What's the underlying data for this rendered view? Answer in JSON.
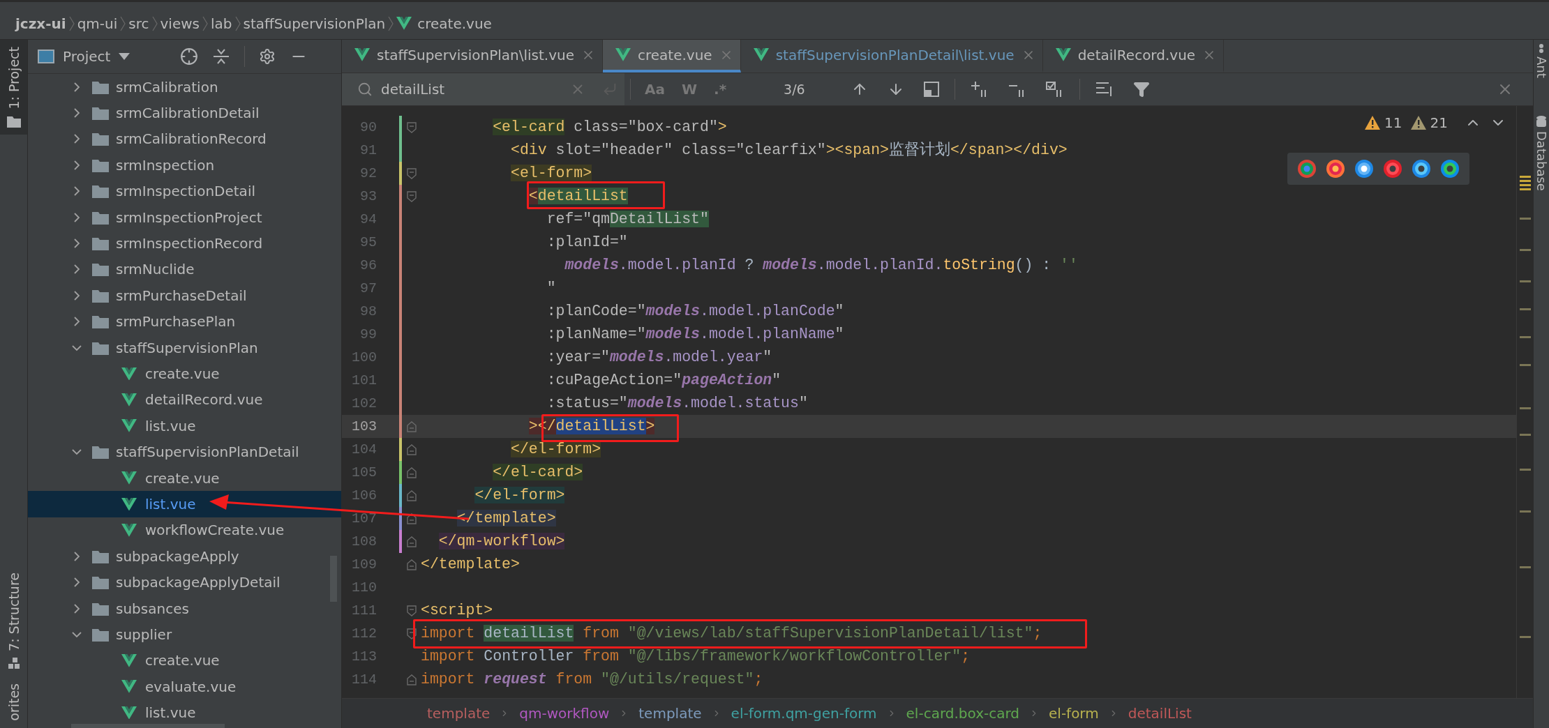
{
  "breadcrumb": [
    {
      "label": "jczx-ui",
      "kind": "project"
    },
    {
      "label": "qm-ui",
      "kind": "folder"
    },
    {
      "label": "src",
      "kind": "folder"
    },
    {
      "label": "views",
      "kind": "folder"
    },
    {
      "label": "lab",
      "kind": "folder"
    },
    {
      "label": "staffSupervisionPlan",
      "kind": "folder"
    },
    {
      "label": "create.vue",
      "kind": "file"
    }
  ],
  "left_tool_windows": [
    {
      "label": "1: Project",
      "selected": true
    },
    {
      "label": "7: Structure",
      "selected": false
    },
    {
      "label": "orites",
      "selected": false
    }
  ],
  "right_tool_windows": [
    {
      "label": "Ant"
    },
    {
      "label": "Database"
    }
  ],
  "project_panel": {
    "title": "Project",
    "tree": [
      {
        "name": "srmCalibration",
        "kind": "folder",
        "expanded": false,
        "selected": false
      },
      {
        "name": "srmCalibrationDetail",
        "kind": "folder",
        "expanded": false,
        "selected": false
      },
      {
        "name": "srmCalibrationRecord",
        "kind": "folder",
        "expanded": false,
        "selected": false
      },
      {
        "name": "srmInspection",
        "kind": "folder",
        "expanded": false,
        "selected": false
      },
      {
        "name": "srmInspectionDetail",
        "kind": "folder",
        "expanded": false,
        "selected": false
      },
      {
        "name": "srmInspectionProject",
        "kind": "folder",
        "expanded": false,
        "selected": false
      },
      {
        "name": "srmInspectionRecord",
        "kind": "folder",
        "expanded": false,
        "selected": false
      },
      {
        "name": "srmNuclide",
        "kind": "folder",
        "expanded": false,
        "selected": false
      },
      {
        "name": "srmPurchaseDetail",
        "kind": "folder",
        "expanded": false,
        "selected": false
      },
      {
        "name": "srmPurchasePlan",
        "kind": "folder",
        "expanded": false,
        "selected": false
      },
      {
        "name": "staffSupervisionPlan",
        "kind": "folder",
        "expanded": true,
        "selected": false,
        "children": [
          {
            "name": "create.vue",
            "kind": "file",
            "selected": false
          },
          {
            "name": "detailRecord.vue",
            "kind": "file",
            "selected": false
          },
          {
            "name": "list.vue",
            "kind": "file",
            "selected": false
          }
        ]
      },
      {
        "name": "staffSupervisionPlanDetail",
        "kind": "folder",
        "expanded": true,
        "selected": false,
        "children": [
          {
            "name": "create.vue",
            "kind": "file",
            "selected": false
          },
          {
            "name": "list.vue",
            "kind": "file",
            "selected": true
          },
          {
            "name": "workflowCreate.vue",
            "kind": "file",
            "selected": false
          }
        ]
      },
      {
        "name": "subpackageApply",
        "kind": "folder",
        "expanded": false,
        "selected": false
      },
      {
        "name": "subpackageApplyDetail",
        "kind": "folder",
        "expanded": false,
        "selected": false
      },
      {
        "name": "subsances",
        "kind": "folder",
        "expanded": false,
        "selected": false
      },
      {
        "name": "supplier",
        "kind": "folder",
        "expanded": true,
        "selected": false,
        "children": [
          {
            "name": "create.vue",
            "kind": "file",
            "selected": false
          },
          {
            "name": "evaluate.vue",
            "kind": "file",
            "selected": false
          },
          {
            "name": "list.vue",
            "kind": "file",
            "selected": false
          }
        ]
      }
    ]
  },
  "tabs": [
    {
      "label": "staffSupervisionPlan\\list.vue",
      "selected": false,
      "modified": false
    },
    {
      "label": "create.vue",
      "selected": true,
      "modified": false
    },
    {
      "label": "staffSupervisionPlanDetail\\list.vue",
      "selected": false,
      "modified": true
    },
    {
      "label": "detailRecord.vue",
      "selected": false,
      "modified": false
    }
  ],
  "search": {
    "value": "detailList",
    "options": [
      "Aa",
      "W",
      ".*"
    ],
    "count": "3/6"
  },
  "editor": {
    "inspections": [
      {
        "kind": "warning",
        "count": "11"
      },
      {
        "kind": "weak-warning",
        "count": "21"
      }
    ],
    "lines": [
      {
        "number": "90",
        "current": false,
        "color": "#6fbf8e",
        "fold_start": true,
        "fold_end": false,
        "tokens": [
          {
            "kind": "tag",
            "text": "        <el-card",
            "color": "#2f3e25"
          },
          {
            "kind": "attr",
            "text": " class=\"box-card\""
          },
          {
            "kind": "tag",
            "text": ">"
          }
        ]
      },
      {
        "number": "91",
        "current": false,
        "color": "#6fbf8e",
        "fold_start": false,
        "fold_end": false,
        "tokens": [
          {
            "kind": "tag",
            "text": "          <div"
          },
          {
            "kind": "attr",
            "text": " slot=\"header\" class=\"clearfix\""
          },
          {
            "kind": "tag",
            "text": "><span>"
          },
          {
            "kind": "text",
            "text": "监督计划"
          },
          {
            "kind": "tag",
            "text": "</span></div>"
          }
        ]
      },
      {
        "number": "92",
        "current": false,
        "color": "#c9c46a",
        "fold_start": true,
        "fold_end": false,
        "tokens": [
          {
            "kind": "tag",
            "text": "          <el-form>",
            "color": "#3d3b22"
          }
        ]
      },
      {
        "number": "93",
        "current": false,
        "color": "#c98376",
        "fold_start": true,
        "fold_end": false,
        "tokens": [
          {
            "kind": "tag",
            "text": "            <",
            "color": "#4d2a2a"
          },
          {
            "kind": "tag",
            "text": "detailList",
            "color": "#32593d"
          }
        ]
      },
      {
        "number": "94",
        "current": false,
        "color": "#c98376",
        "fold_start": false,
        "fold_end": false,
        "tokens": [
          {
            "kind": "attr",
            "text": "              ref=\"qm"
          },
          {
            "kind": "attr",
            "text": "DetailList\"",
            "color": "#32593d"
          }
        ]
      },
      {
        "number": "95",
        "current": false,
        "color": "#c98376",
        "fold_start": false,
        "fold_end": false,
        "tokens": [
          {
            "kind": "attr",
            "text": "              :planId=\""
          }
        ]
      },
      {
        "number": "96",
        "current": false,
        "color": "#c98376",
        "fold_start": false,
        "fold_end": false,
        "tokens": [
          {
            "kind": "var",
            "text": "                models"
          },
          {
            "kind": "prop",
            "text": ".model.planId "
          },
          {
            "kind": "text",
            "text": "? "
          },
          {
            "kind": "var",
            "text": "models"
          },
          {
            "kind": "prop",
            "text": ".model.planId."
          },
          {
            "kind": "func",
            "text": "toString"
          },
          {
            "kind": "text",
            "text": "() : "
          },
          {
            "kind": "jsstr",
            "text": "''"
          }
        ]
      },
      {
        "number": "97",
        "current": false,
        "color": "#c98376",
        "fold_start": false,
        "fold_end": false,
        "tokens": [
          {
            "kind": "attr",
            "text": "              \""
          }
        ]
      },
      {
        "number": "98",
        "current": false,
        "color": "#c98376",
        "fold_start": false,
        "fold_end": false,
        "tokens": [
          {
            "kind": "attr",
            "text": "              :planCode=\""
          },
          {
            "kind": "var",
            "text": "models"
          },
          {
            "kind": "prop",
            "text": ".model.planCode"
          },
          {
            "kind": "attr",
            "text": "\""
          }
        ]
      },
      {
        "number": "99",
        "current": false,
        "color": "#c98376",
        "fold_start": false,
        "fold_end": false,
        "tokens": [
          {
            "kind": "attr",
            "text": "              :planName=\""
          },
          {
            "kind": "var",
            "text": "models"
          },
          {
            "kind": "prop",
            "text": ".model.planName"
          },
          {
            "kind": "attr",
            "text": "\""
          }
        ]
      },
      {
        "number": "100",
        "current": false,
        "color": "#c98376",
        "fold_start": false,
        "fold_end": false,
        "tokens": [
          {
            "kind": "attr",
            "text": "              :year=\""
          },
          {
            "kind": "var",
            "text": "models"
          },
          {
            "kind": "prop",
            "text": ".model.year"
          },
          {
            "kind": "attr",
            "text": "\""
          }
        ]
      },
      {
        "number": "101",
        "current": false,
        "color": "#c98376",
        "fold_start": false,
        "fold_end": false,
        "tokens": [
          {
            "kind": "attr",
            "text": "              :cuPageAction=\""
          },
          {
            "kind": "var",
            "text": "pageAction"
          },
          {
            "kind": "attr",
            "text": "\""
          }
        ]
      },
      {
        "number": "102",
        "current": false,
        "color": "#c98376",
        "fold_start": false,
        "fold_end": false,
        "tokens": [
          {
            "kind": "attr",
            "text": "              :status=\""
          },
          {
            "kind": "var",
            "text": "models"
          },
          {
            "kind": "prop",
            "text": ".model.status"
          },
          {
            "kind": "attr",
            "text": "\""
          }
        ]
      },
      {
        "number": "103",
        "current": true,
        "color": "#c98376",
        "fold_start": false,
        "fold_end": true,
        "tokens": [
          {
            "kind": "tag",
            "text": "            >",
            "color": "#4d2a2a"
          },
          {
            "kind": "tag",
            "text": "</",
            "color": "#4d2a2a"
          },
          {
            "kind": "tag",
            "text": "detailList",
            "color": "#214283"
          },
          {
            "kind": "tag",
            "text": ">",
            "color": "#4d2a2a"
          }
        ]
      },
      {
        "number": "104",
        "current": false,
        "color": "#c9c46a",
        "fold_start": false,
        "fold_end": true,
        "tokens": [
          {
            "kind": "tag",
            "text": "          </el-form>",
            "color": "#3d3b22"
          }
        ]
      },
      {
        "number": "105",
        "current": false,
        "color": "#78c26a",
        "fold_start": false,
        "fold_end": true,
        "tokens": [
          {
            "kind": "tag",
            "text": "        </el-card>",
            "color": "#2f3e25"
          }
        ]
      },
      {
        "number": "106",
        "current": false,
        "color": "#6ab8c9",
        "fold_start": false,
        "fold_end": true,
        "tokens": [
          {
            "kind": "tag",
            "text": "      </el-form>",
            "color": "#213b3b"
          }
        ]
      },
      {
        "number": "107",
        "current": false,
        "color": "#8a8fd0",
        "fold_start": false,
        "fold_end": true,
        "tokens": [
          {
            "kind": "tag",
            "text": "    </template>",
            "color": "#2f3544"
          }
        ]
      },
      {
        "number": "108",
        "current": false,
        "color": "#c97ed0",
        "fold_start": false,
        "fold_end": true,
        "tokens": [
          {
            "kind": "tag",
            "text": "  </qm-workflow>",
            "color": "#3a2a3e"
          }
        ]
      },
      {
        "number": "109",
        "current": false,
        "fold_start": false,
        "fold_end": true,
        "tokens": [
          {
            "kind": "tag",
            "text": "</template>"
          }
        ]
      },
      {
        "number": "110",
        "current": false,
        "fold_start": false,
        "fold_end": false
      },
      {
        "number": "111",
        "current": false,
        "fold_start": true,
        "fold_end": false,
        "tokens": [
          {
            "kind": "tag",
            "text": "<script>"
          }
        ]
      },
      {
        "number": "112",
        "current": false,
        "fold_start": true,
        "fold_end": false,
        "tokens": [
          {
            "kind": "kw",
            "text": "import "
          },
          {
            "kind": "text",
            "text": "detailList",
            "color": "#32593d"
          },
          {
            "kind": "kw",
            "text": " from "
          },
          {
            "kind": "jsstr",
            "text": "\"@/views/lab/staffSupervisionPlanDetail/list\""
          },
          {
            "kind": "kw",
            "text": ";"
          }
        ]
      },
      {
        "number": "113",
        "current": false,
        "fold_start": false,
        "fold_end": false,
        "tokens": [
          {
            "kind": "kw",
            "text": "import "
          },
          {
            "kind": "text",
            "text": "Controller"
          },
          {
            "kind": "kw",
            "text": " from "
          },
          {
            "kind": "jsstr",
            "text": "\"@/libs/framework/workflowController\""
          },
          {
            "kind": "kw",
            "text": ";"
          }
        ]
      },
      {
        "number": "114",
        "current": false,
        "fold_start": false,
        "fold_end": true,
        "tokens": [
          {
            "kind": "kw",
            "text": "import "
          },
          {
            "kind": "var",
            "text": "request"
          },
          {
            "kind": "kw",
            "text": " from "
          },
          {
            "kind": "jsstr",
            "text": "\"@/utils/request\""
          },
          {
            "kind": "kw",
            "text": ";"
          }
        ]
      }
    ]
  },
  "code_breadcrumb": [
    {
      "label": "template",
      "color": "#b85f5f"
    },
    {
      "label": "qm-workflow",
      "color": "#b058c0"
    },
    {
      "label": "template",
      "color": "#7d9bbd"
    },
    {
      "label": "el-form.qm-gen-form",
      "color": "#3fa1a1"
    },
    {
      "label": "el-card.box-card",
      "color": "#5fa84f"
    },
    {
      "label": "el-form",
      "color": "#b8b24f"
    },
    {
      "label": "detailList",
      "color": "#c05858"
    }
  ]
}
